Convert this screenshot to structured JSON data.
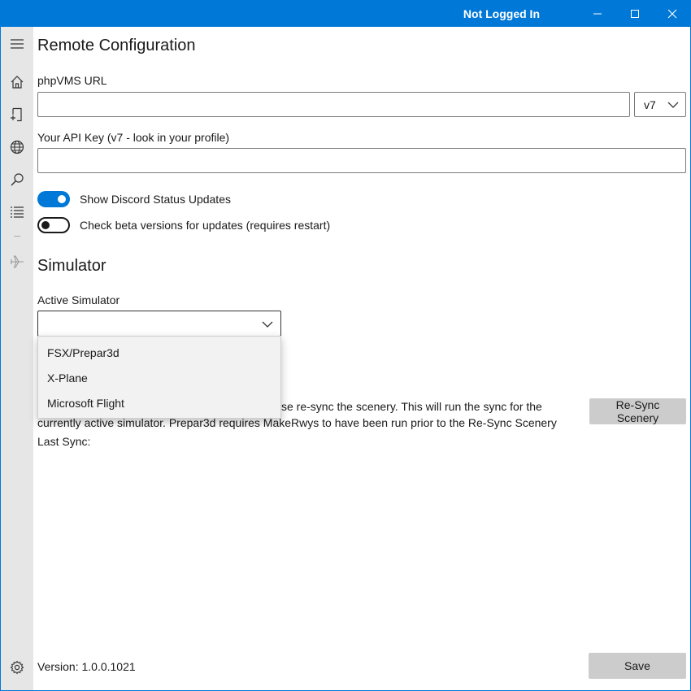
{
  "titlebar": {
    "title": "Not Logged In"
  },
  "sidebar": {
    "items": [
      {
        "icon": "hamburger-menu-icon"
      },
      {
        "icon": "home-icon"
      },
      {
        "icon": "add-document-icon"
      },
      {
        "icon": "globe-icon"
      },
      {
        "icon": "search-icon"
      },
      {
        "icon": "list-icon"
      },
      {
        "icon": "airplane-icon",
        "disabled": true
      }
    ],
    "settings_icon": "gear-icon"
  },
  "remote": {
    "heading": "Remote Configuration",
    "url_label": "phpVMS URL",
    "url_value": "",
    "version_value": "v7",
    "apikey_label": "Your API Key (v7 - look in your profile)",
    "apikey_value": "",
    "discord_label": "Show Discord Status Updates",
    "discord_on": true,
    "beta_label": "Check beta versions for updates (requires restart)",
    "beta_on": false
  },
  "simulator": {
    "heading": "Simulator",
    "active_label": "Active Simulator",
    "active_value": "",
    "options": [
      "FSX/Prepar3d",
      "X-Plane",
      "Microsoft Flight"
    ],
    "resync_line1_visible": "se re-sync the scenery. This will run the sync for the",
    "resync_line2": "currently active simulator. Prepar3d requires MakeRwys to have been run prior to the Re-Sync Scenery",
    "last_sync_label": "Last Sync:",
    "resync_button": "Re-Sync Scenery"
  },
  "footer": {
    "version": "Version: 1.0.0.1021",
    "save_button": "Save"
  },
  "colors": {
    "accent": "#0078d7",
    "sidebar_bg": "#e6e6e6",
    "button_bg": "#cccccc"
  }
}
